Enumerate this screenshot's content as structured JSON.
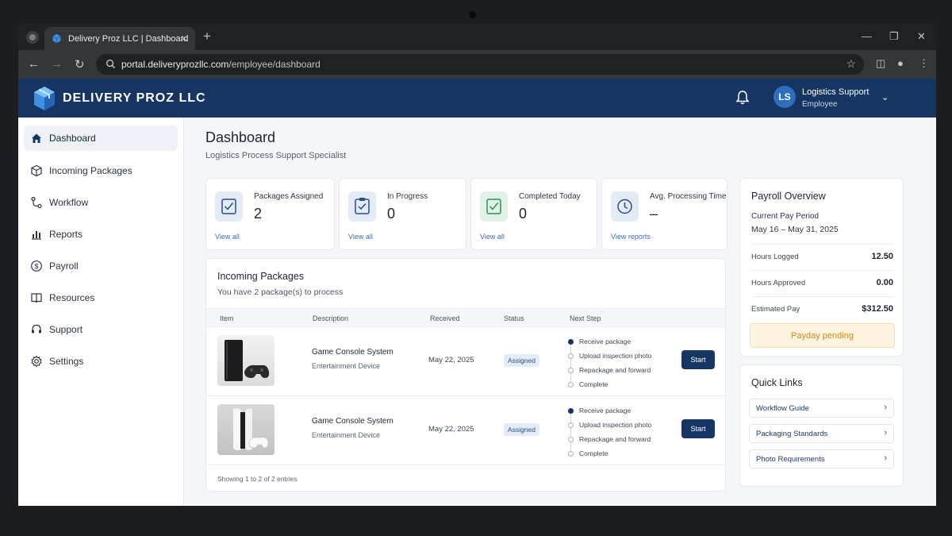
{
  "browser": {
    "tab_title": "Delivery Proz LLC | Dashboard",
    "url_domain": "portal.deliveryprozllc.com",
    "url_path": "/employee/dashboard"
  },
  "header": {
    "brand": "DELIVERY PROZ LLC",
    "user_initials": "LS",
    "user_name": "Logistics Support",
    "user_role": "Employee"
  },
  "sidebar": {
    "items": [
      {
        "label": "Dashboard",
        "icon": "home-icon",
        "active": true
      },
      {
        "label": "Incoming Packages",
        "icon": "package-icon"
      },
      {
        "label": "Workflow",
        "icon": "workflow-icon"
      },
      {
        "label": "Reports",
        "icon": "bar-chart-icon"
      },
      {
        "label": "Payroll",
        "icon": "dollar-icon"
      },
      {
        "label": "Resources",
        "icon": "book-icon"
      },
      {
        "label": "Support",
        "icon": "headset-icon"
      },
      {
        "label": "Settings",
        "icon": "gear-icon"
      }
    ]
  },
  "page": {
    "title": "Dashboard",
    "subtitle": "Logistics Process Support Specialist"
  },
  "stats": [
    {
      "label": "Packages Assigned",
      "value": "2",
      "link": "View all",
      "icon": "checklist-icon"
    },
    {
      "label": "In Progress",
      "value": "0",
      "link": "View all",
      "icon": "clipboard-icon"
    },
    {
      "label": "Completed Today",
      "value": "0",
      "link": "View all",
      "icon": "check-icon"
    },
    {
      "label": "Avg. Processing Time",
      "value": "–",
      "link": "View reports",
      "icon": "clock-icon"
    }
  ],
  "incoming": {
    "title": "Incoming Packages",
    "subtitle": "You have 2 package(s) to process",
    "columns": [
      "Item",
      "Description",
      "Received",
      "Status",
      "Next Step"
    ],
    "rows": [
      {
        "name": "Game Console System",
        "category": "Entertainment Device",
        "received": "May 22, 2025",
        "status": "Assigned",
        "steps": [
          "Receive package",
          "Upload inspection photo",
          "Repackage and forward",
          "Complete"
        ],
        "current_step": 0,
        "action": "Start"
      },
      {
        "name": "Game Console System",
        "category": "Entertainment Device",
        "received": "May 22, 2025",
        "status": "Assigned",
        "steps": [
          "Receive package",
          "Upload inspection photo",
          "Repackage and forward",
          "Complete"
        ],
        "current_step": 0,
        "action": "Start"
      }
    ],
    "footer": "Showing 1 to 2 of 2 entries"
  },
  "payroll": {
    "title": "Payroll Overview",
    "period_label": "Current Pay Period",
    "period_value": "May 16 – May 31, 2025",
    "lines": [
      {
        "label": "Hours Logged",
        "value": "12.50"
      },
      {
        "label": "Hours Approved",
        "value": "0.00"
      },
      {
        "label": "Estimated Pay",
        "value": "$312.50"
      }
    ],
    "status": "Payday pending"
  },
  "quick_links": {
    "title": "Quick Links",
    "items": [
      "Workflow Guide",
      "Packaging Standards",
      "Photo Requirements"
    ]
  },
  "colors": {
    "brand_navy": "#163562",
    "avatar_blue": "#2e6fbd",
    "payday_bg": "#fdf3de",
    "payday_text": "#c88a1e"
  }
}
